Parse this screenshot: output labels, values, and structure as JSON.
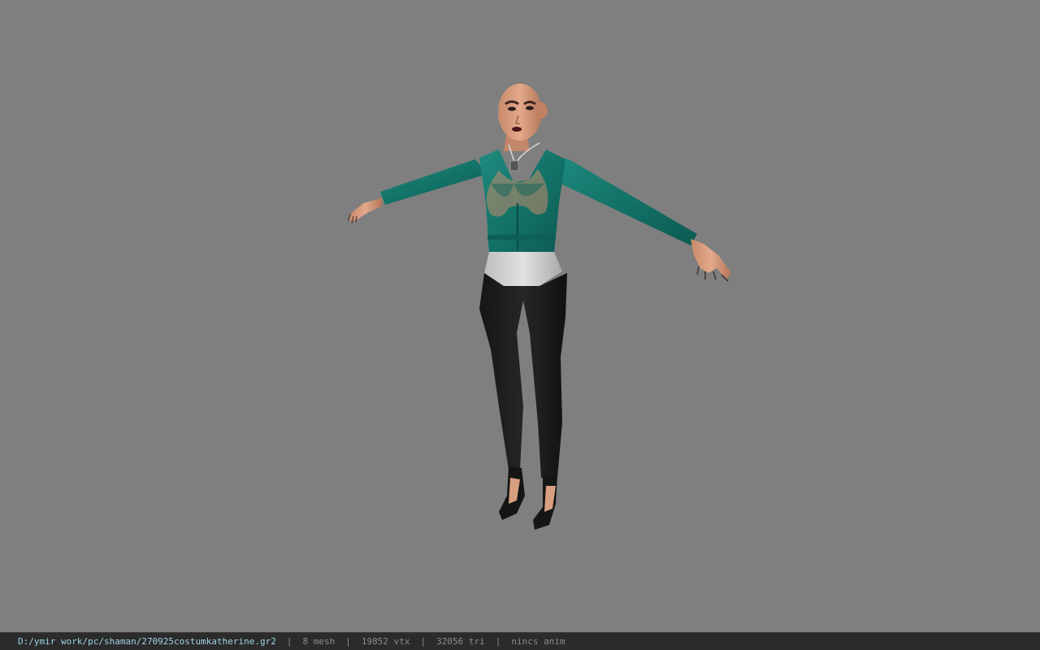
{
  "status_bar": {
    "file_path": "D:/ymir work/pc/shaman/270925costumkatherine.gr2",
    "separator": "|",
    "mesh_count": "8 mesh",
    "vertex_count": "19852 vtx",
    "triangle_count": "32056 tri",
    "animation": "nincs anim"
  },
  "colors": {
    "viewport_bg": "#7f7f7f",
    "status_bg": "#2b2b2b",
    "path_text": "#9fd4e6",
    "status_text": "#8c8c8c"
  },
  "model": {
    "type": "character-mesh",
    "pose": "t-pose"
  }
}
